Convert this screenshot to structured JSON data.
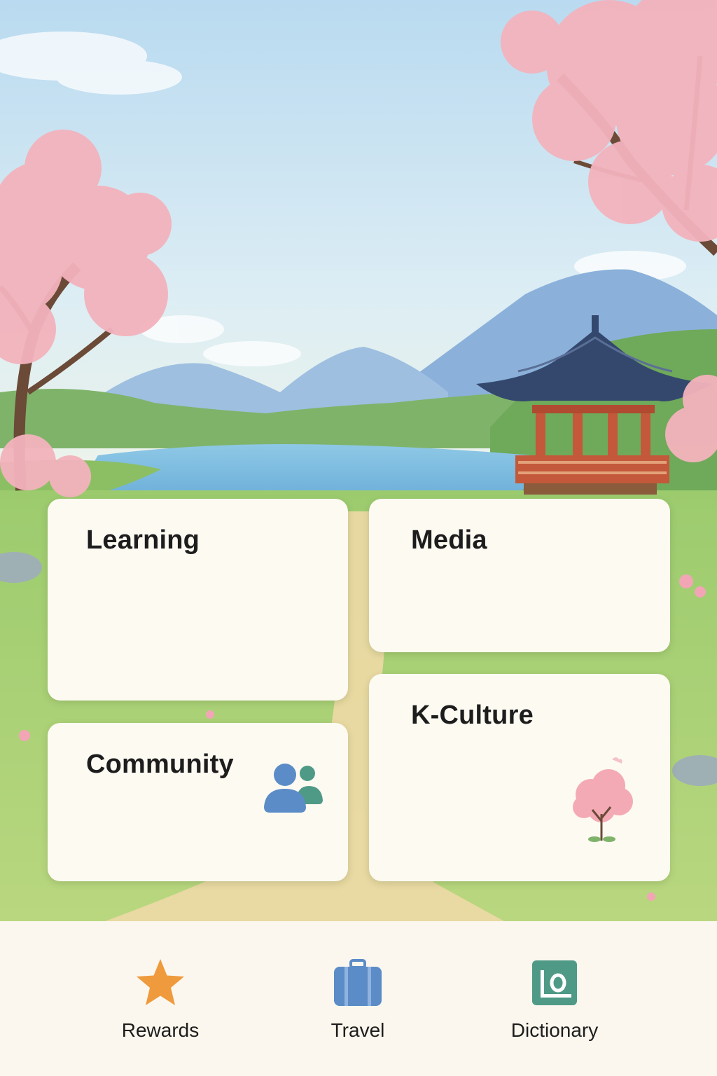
{
  "cards": {
    "learning": {
      "title": "Learning"
    },
    "media": {
      "title": "Media"
    },
    "community": {
      "title": "Community",
      "icon": "people-icon"
    },
    "kculture": {
      "title": "K-Culture",
      "icon": "cherry-blossom-tree-icon"
    }
  },
  "bottom_nav": {
    "items": [
      {
        "label": "Rewards",
        "icon": "star-icon",
        "color": "#ef9a3c"
      },
      {
        "label": "Travel",
        "icon": "suitcase-icon",
        "color": "#5b8cc7"
      },
      {
        "label": "Dictionary",
        "icon": "dictionary-icon",
        "color": "#4f9a87"
      }
    ]
  },
  "colors": {
    "sky": "#cfe6f2",
    "blossom": "#f3b3bd",
    "card_background": "#fdfaf2",
    "nav_background": "#fbf7ee",
    "pavilion_roof": "#34486e",
    "pavilion_pillars": "#c4583a"
  }
}
